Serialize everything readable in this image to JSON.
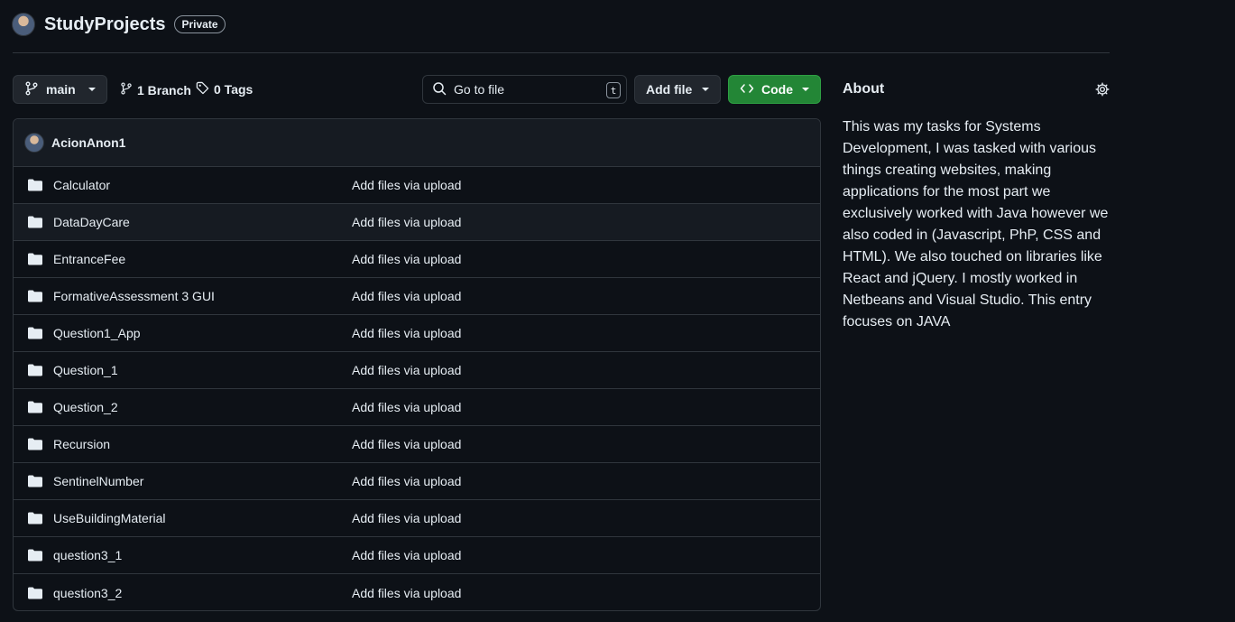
{
  "repo": {
    "name": "StudyProjects",
    "visibility": "Private",
    "avatar_icon": "user-avatar"
  },
  "toolbar": {
    "branch_label": "main",
    "branches_label": "1 Branch",
    "tags_label": "0 Tags",
    "search_placeholder": "Go to file",
    "search_shortcut": "t",
    "add_file_label": "Add file",
    "code_label": "Code"
  },
  "commit": {
    "author": "AcionAnon1"
  },
  "files": [
    {
      "name": "Calculator",
      "message": "Add files via upload"
    },
    {
      "name": "DataDayCare",
      "message": "Add files via upload"
    },
    {
      "name": "EntranceFee",
      "message": "Add files via upload"
    },
    {
      "name": "FormativeAssessment 3 GUI",
      "message": "Add files via upload"
    },
    {
      "name": "Question1_App",
      "message": "Add files via upload"
    },
    {
      "name": "Question_1",
      "message": "Add files via upload"
    },
    {
      "name": "Question_2",
      "message": "Add files via upload"
    },
    {
      "name": "Recursion",
      "message": "Add files via upload"
    },
    {
      "name": "SentinelNumber",
      "message": "Add files via upload"
    },
    {
      "name": "UseBuildingMaterial",
      "message": "Add files via upload"
    },
    {
      "name": "question3_1",
      "message": "Add files via upload"
    },
    {
      "name": "question3_2",
      "message": "Add files via upload"
    }
  ],
  "about": {
    "title": "About",
    "description": "This was my tasks for Systems Development, I was tasked with various things creating websites, making applications for the most part we exclusively worked with Java however we also coded in (Javascript, PhP, CSS and HTML). We also touched on libraries like React and jQuery. I mostly worked in Netbeans and Visual Studio. This entry focuses on JAVA"
  },
  "colors": {
    "background": "#0d1117",
    "border": "#30363d",
    "code_button": "#238636",
    "text": "#e6edf3"
  }
}
